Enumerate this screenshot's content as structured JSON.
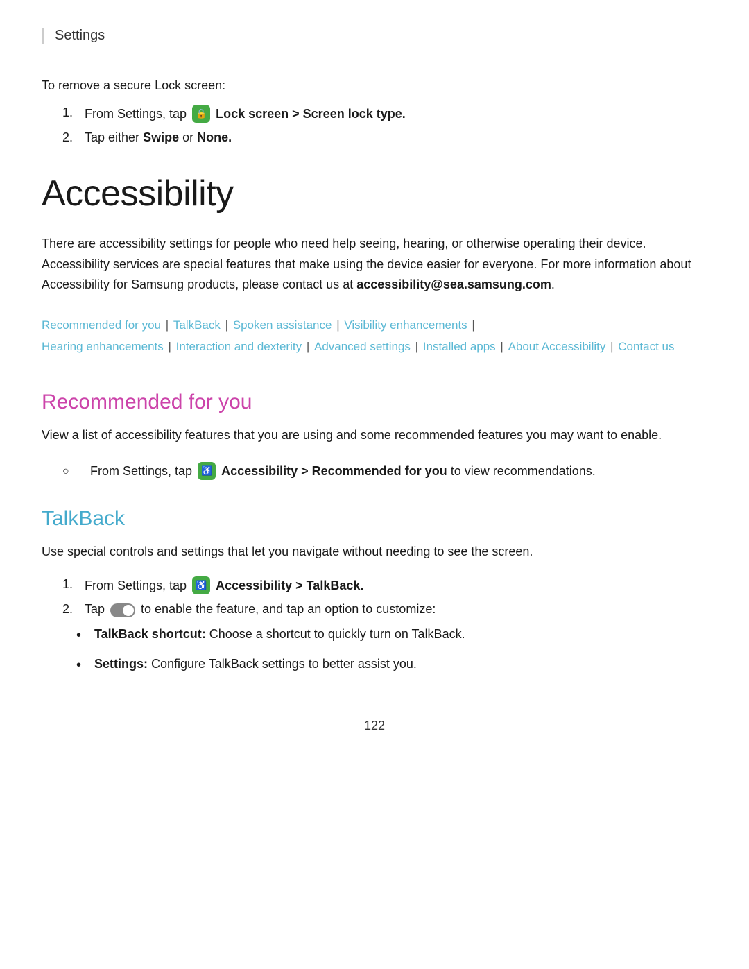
{
  "header": {
    "title": "Settings"
  },
  "intro": {
    "remove_lock_text": "To remove a secure Lock screen:",
    "step1_prefix": "From Settings, tap",
    "step1_bold": "Lock screen > Screen lock type.",
    "step2_prefix": "Tap either",
    "step2_swipe": "Swipe",
    "step2_connector": "or",
    "step2_none": "None."
  },
  "page_title": "Accessibility",
  "description": "There are accessibility settings for people who need help seeing, hearing, or otherwise operating their device. Accessibility services are special features that make using the device easier for everyone. For more information about Accessibility for Samsung products, please contact us at accessibility@sea.samsung.com.",
  "nav_links": {
    "items": [
      "Recommended for you",
      "TalkBack",
      "Spoken assistance",
      "Visibility enhancements",
      "Hearing enhancements",
      "Interaction and dexterity",
      "Advanced settings",
      "Installed apps",
      "About Accessibility",
      "Contact us"
    ]
  },
  "sections": [
    {
      "id": "recommended",
      "heading": "Recommended for you",
      "body": "View a list of accessibility features that you are using and some recommended features you may want to enable.",
      "list_type": "circle",
      "items": [
        {
          "prefix": "From Settings, tap",
          "bold": "Accessibility > Recommended for you",
          "suffix": "to view recommendations."
        }
      ]
    },
    {
      "id": "talkback",
      "heading": "TalkBack",
      "body": "Use special controls and settings that let you navigate without needing to see the screen.",
      "list_type": "ordered",
      "items": [
        {
          "prefix": "From Settings, tap",
          "bold": "Accessibility > TalkBack."
        },
        {
          "prefix": "Tap",
          "has_toggle": true,
          "suffix": "to enable the feature, and tap an option to customize:"
        }
      ],
      "sub_bullets": [
        {
          "bold": "TalkBack shortcut:",
          "text": "Choose a shortcut to quickly turn on TalkBack."
        },
        {
          "bold": "Settings:",
          "text": "Configure TalkBack settings to better assist you."
        }
      ]
    }
  ],
  "page_number": "122"
}
